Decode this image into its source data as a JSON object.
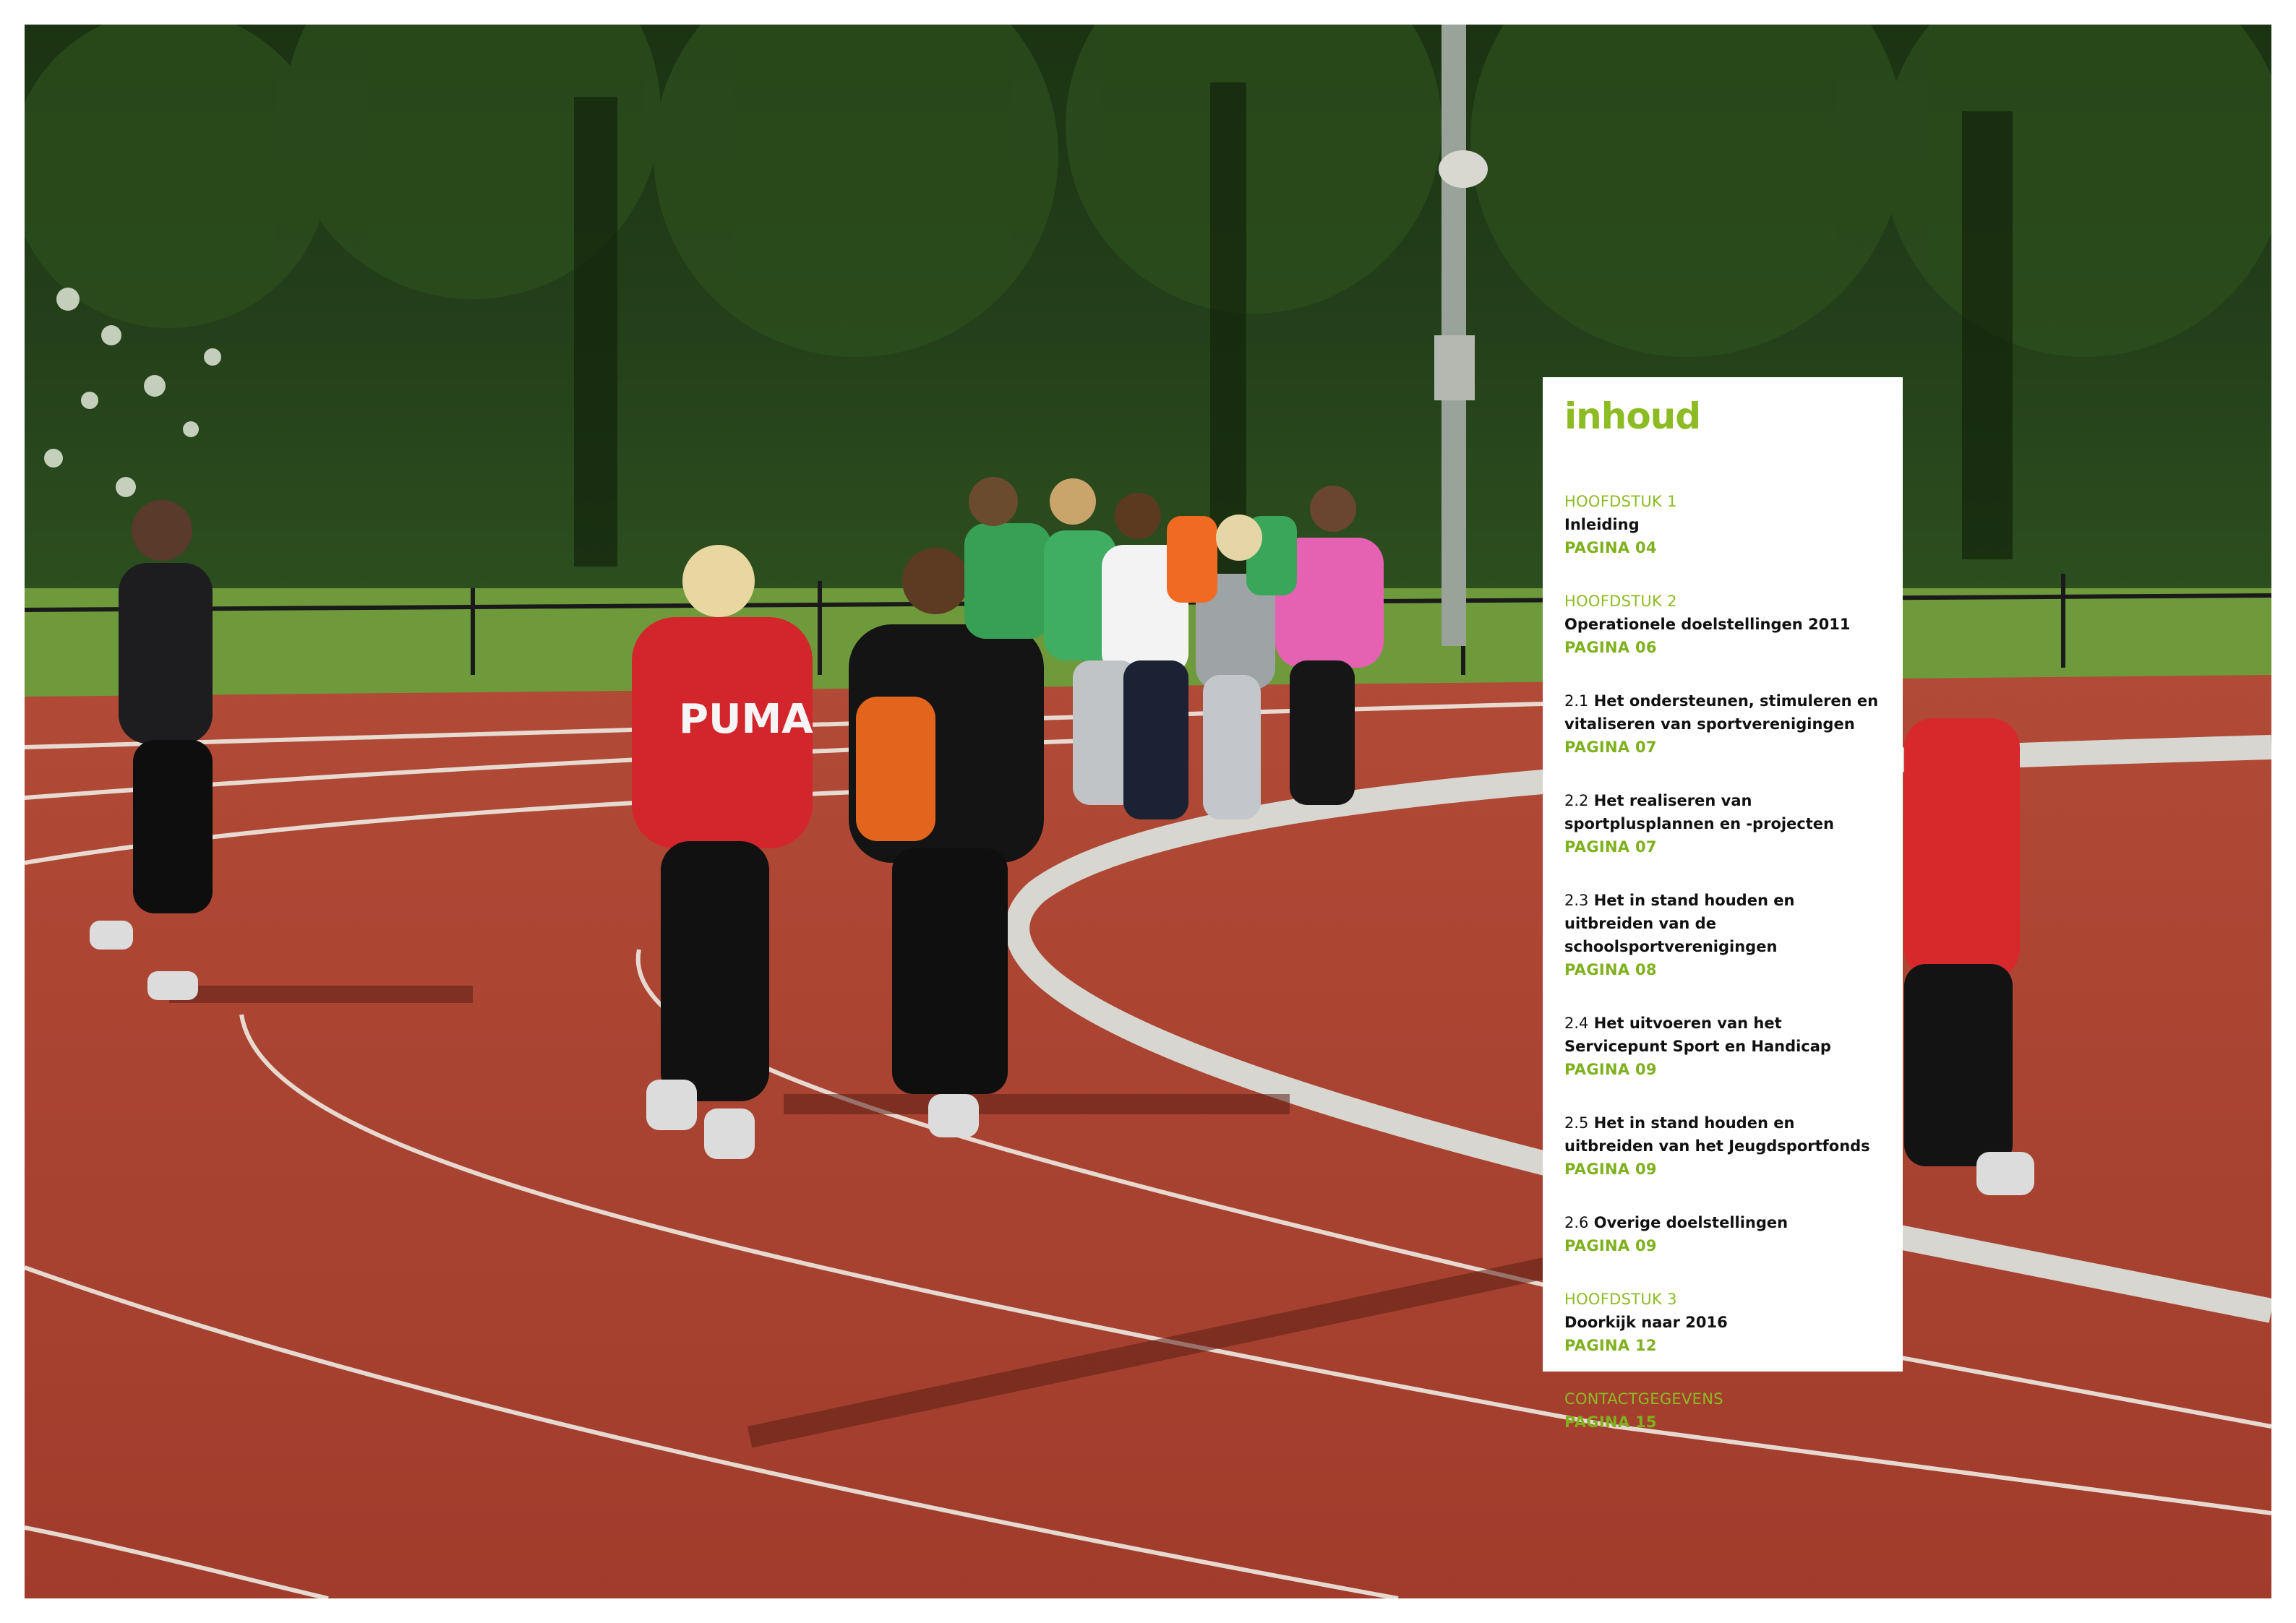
{
  "photo": {
    "description_icon": "athletics-track-photo",
    "jersey_text": "PUMA"
  },
  "toc": {
    "title": "inhoud",
    "entries": [
      {
        "kicker": "HOOFDSTUK 1",
        "number": "",
        "title": "Inleiding",
        "page": "PAGINA 04"
      },
      {
        "kicker": "HOOFDSTUK 2",
        "number": "",
        "title": "Operationele doelstellingen 2011",
        "page": "PAGINA 06"
      },
      {
        "kicker": "",
        "number": "2.1",
        "title": "Het ondersteunen, stimuleren en vitaliseren van sportverenigingen",
        "page": "PAGINA 07"
      },
      {
        "kicker": "",
        "number": "2.2",
        "title": "Het realiseren van sportplusplannen en -projecten",
        "page": "PAGINA 07"
      },
      {
        "kicker": "",
        "number": "2.3",
        "title": "Het in stand houden en uitbreiden van de schoolsportverenigingen",
        "page": "PAGINA 08"
      },
      {
        "kicker": "",
        "number": "2.4",
        "title": "Het uitvoeren van het Servicepunt Sport en Handicap",
        "page": "PAGINA 09"
      },
      {
        "kicker": "",
        "number": "2.5",
        "title": "Het in stand houden en uitbreiden van het Jeugdsportfonds",
        "page": "PAGINA 09"
      },
      {
        "kicker": "",
        "number": "2.6",
        "title": "Overige doelstellingen",
        "page": "PAGINA 09"
      },
      {
        "kicker": "HOOFDSTUK 3",
        "number": "",
        "title": "Doorkijk naar 2016",
        "page": "PAGINA 12"
      },
      {
        "kicker": "CONTACTGEGEVENS",
        "number": "",
        "title": "",
        "page": "PAGINA 15"
      }
    ]
  },
  "colors": {
    "accent": "#8dbb24",
    "track": "#a9412f",
    "grass": "#6f9a3c",
    "trees": "#1f3a14"
  }
}
